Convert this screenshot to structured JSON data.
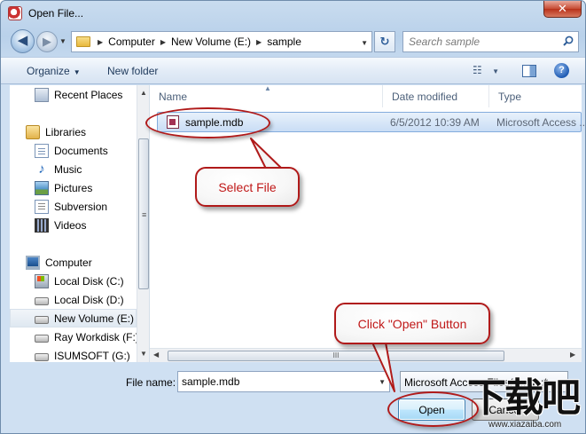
{
  "window": {
    "title": "Open File...",
    "close_label": "✕"
  },
  "address": {
    "back_label": "◀",
    "forward_label": "▶",
    "breadcrumb": [
      "Computer",
      "New Volume (E:)",
      "sample"
    ],
    "refresh_label": "↻",
    "search_placeholder": "Search sample"
  },
  "toolbar": {
    "organize": "Organize",
    "new_folder": "New folder",
    "help_label": "?"
  },
  "nav_pane": {
    "items": [
      {
        "label": "Recent Places",
        "icon": "recent-places-icon"
      },
      {
        "label": "Libraries",
        "icon": "libraries-icon"
      },
      {
        "label": "Documents",
        "icon": "documents-icon"
      },
      {
        "label": "Music",
        "icon": "music-icon"
      },
      {
        "label": "Pictures",
        "icon": "pictures-icon"
      },
      {
        "label": "Subversion",
        "icon": "subversion-icon"
      },
      {
        "label": "Videos",
        "icon": "videos-icon"
      },
      {
        "label": "Computer",
        "icon": "computer-icon"
      },
      {
        "label": "Local Disk (C:)",
        "icon": "system-disk-icon"
      },
      {
        "label": "Local Disk (D:)",
        "icon": "disk-icon"
      },
      {
        "label": "New Volume (E:)",
        "icon": "disk-icon",
        "selected": true
      },
      {
        "label": "Ray Workdisk (F:)",
        "icon": "disk-icon"
      },
      {
        "label": "ISUMSOFT (G:)",
        "icon": "disk-icon"
      }
    ]
  },
  "file_list": {
    "columns": [
      "Name",
      "Date modified",
      "Type"
    ],
    "rows": [
      {
        "name": "sample.mdb",
        "date_modified": "6/5/2012 10:39 AM",
        "type": "Microsoft Access ..."
      }
    ],
    "hscroll_grip": "III"
  },
  "bottom": {
    "file_name_label": "File name:",
    "file_name_value": "sample.mdb",
    "file_type_value": "Microsoft Access Files(*.mdb;*.",
    "open_label": "Open",
    "cancel_label": "Cancel"
  },
  "annotations": {
    "select_file": "Select File",
    "click_open": "Click \"Open\" Button",
    "color": "#b01a1a"
  },
  "watermark": {
    "text": "下载吧",
    "url": "www.xiazaiba.com"
  }
}
